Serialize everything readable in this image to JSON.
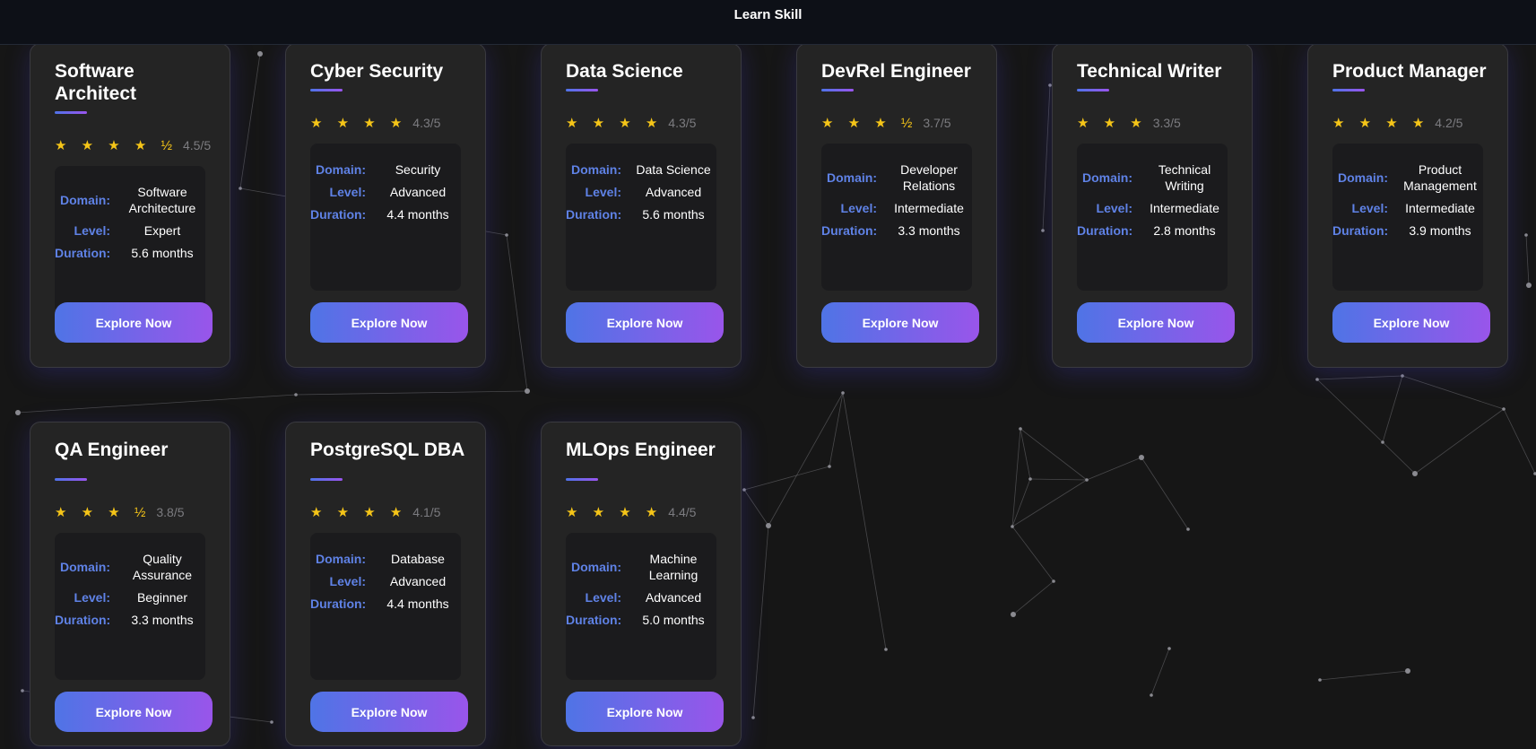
{
  "header": {
    "title": "Learn Skill"
  },
  "labels": {
    "domain": "Domain:",
    "level": "Level:",
    "duration": "Duration:"
  },
  "cards": [
    {
      "title": "Software Architect",
      "stars": "★ ★ ★ ★ ½",
      "rating": "4.5/5",
      "domain": "Software Architecture",
      "level": "Expert",
      "duration": "5.6 months",
      "button": "Explore Now"
    },
    {
      "title": "Cyber Security",
      "stars": "★ ★ ★ ★",
      "rating": "4.3/5",
      "domain": "Security",
      "level": "Advanced",
      "duration": "4.4 months",
      "button": "Explore Now"
    },
    {
      "title": "Data Science",
      "stars": "★ ★ ★ ★",
      "rating": "4.3/5",
      "domain": "Data Science",
      "level": "Advanced",
      "duration": "5.6 months",
      "button": "Explore Now"
    },
    {
      "title": "DevRel Engineer",
      "stars": "★ ★ ★ ½",
      "rating": "3.7/5",
      "domain": "Developer Relations",
      "level": "Intermediate",
      "duration": "3.3 months",
      "button": "Explore Now"
    },
    {
      "title": "Technical Writer",
      "stars": "★ ★ ★",
      "rating": "3.3/5",
      "domain": "Technical Writing",
      "level": "Intermediate",
      "duration": "2.8 months",
      "button": "Explore Now"
    },
    {
      "title": "Product Manager",
      "stars": "★ ★ ★ ★",
      "rating": "4.2/5",
      "domain": "Product Management",
      "level": "Intermediate",
      "duration": "3.9 months",
      "button": "Explore Now"
    },
    {
      "title": "QA Engineer",
      "stars": "★ ★ ★ ½",
      "rating": "3.8/5",
      "domain": "Quality Assurance",
      "level": "Beginner",
      "duration": "3.3 months",
      "button": "Explore Now"
    },
    {
      "title": "PostgreSQL DBA",
      "stars": "★ ★ ★ ★",
      "rating": "4.1/5",
      "domain": "Database",
      "level": "Advanced",
      "duration": "4.4 months",
      "button": "Explore Now"
    },
    {
      "title": "MLOps Engineer",
      "stars": "★ ★ ★ ★",
      "rating": "4.4/5",
      "domain": "Machine Learning",
      "level": "Advanced",
      "duration": "5.0 months",
      "button": "Explore Now"
    }
  ],
  "colors": {
    "background": "#161616",
    "card": "#242424",
    "accent_start": "#4f74e6",
    "accent_end": "#9955ea",
    "label": "#5f82e6",
    "star": "#f5c518"
  }
}
